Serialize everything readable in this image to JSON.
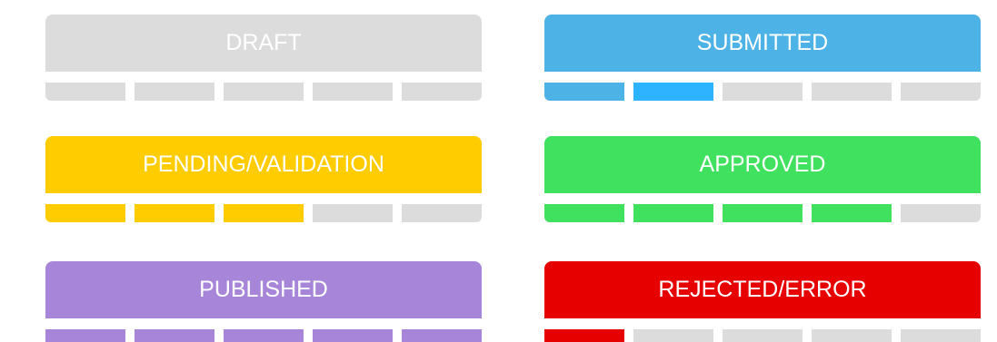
{
  "statuses": [
    {
      "label": "DRAFT",
      "color": "#dcdcdc",
      "segments": [
        "#dcdcdc",
        "#dcdcdc",
        "#dcdcdc",
        "#dcdcdc",
        "#dcdcdc"
      ]
    },
    {
      "label": "SUBMITTED",
      "color": "#4db3e6",
      "segments": [
        "#4db3e6",
        "#2eb4ff",
        "#dcdcdc",
        "#dcdcdc",
        "#dcdcdc"
      ]
    },
    {
      "label": "PENDING/VALIDATION",
      "color": "#ffcc00",
      "segments": [
        "#ffcc00",
        "#ffcc00",
        "#ffcc00",
        "#dcdcdc",
        "#dcdcdc"
      ]
    },
    {
      "label": "APPROVED",
      "color": "#3fe15f",
      "segments": [
        "#3fe15f",
        "#3fe15f",
        "#3fe15f",
        "#3fe15f",
        "#dcdcdc"
      ]
    },
    {
      "label": "PUBLISHED",
      "color": "#a786d9",
      "segments": [
        "#a786d9",
        "#a786d9",
        "#a786d9",
        "#a786d9",
        "#a786d9"
      ]
    },
    {
      "label": "REJECTED/ERROR",
      "color": "#e60000",
      "segments": [
        "#e60000",
        "#dcdcdc",
        "#dcdcdc",
        "#dcdcdc",
        "#dcdcdc"
      ]
    }
  ]
}
